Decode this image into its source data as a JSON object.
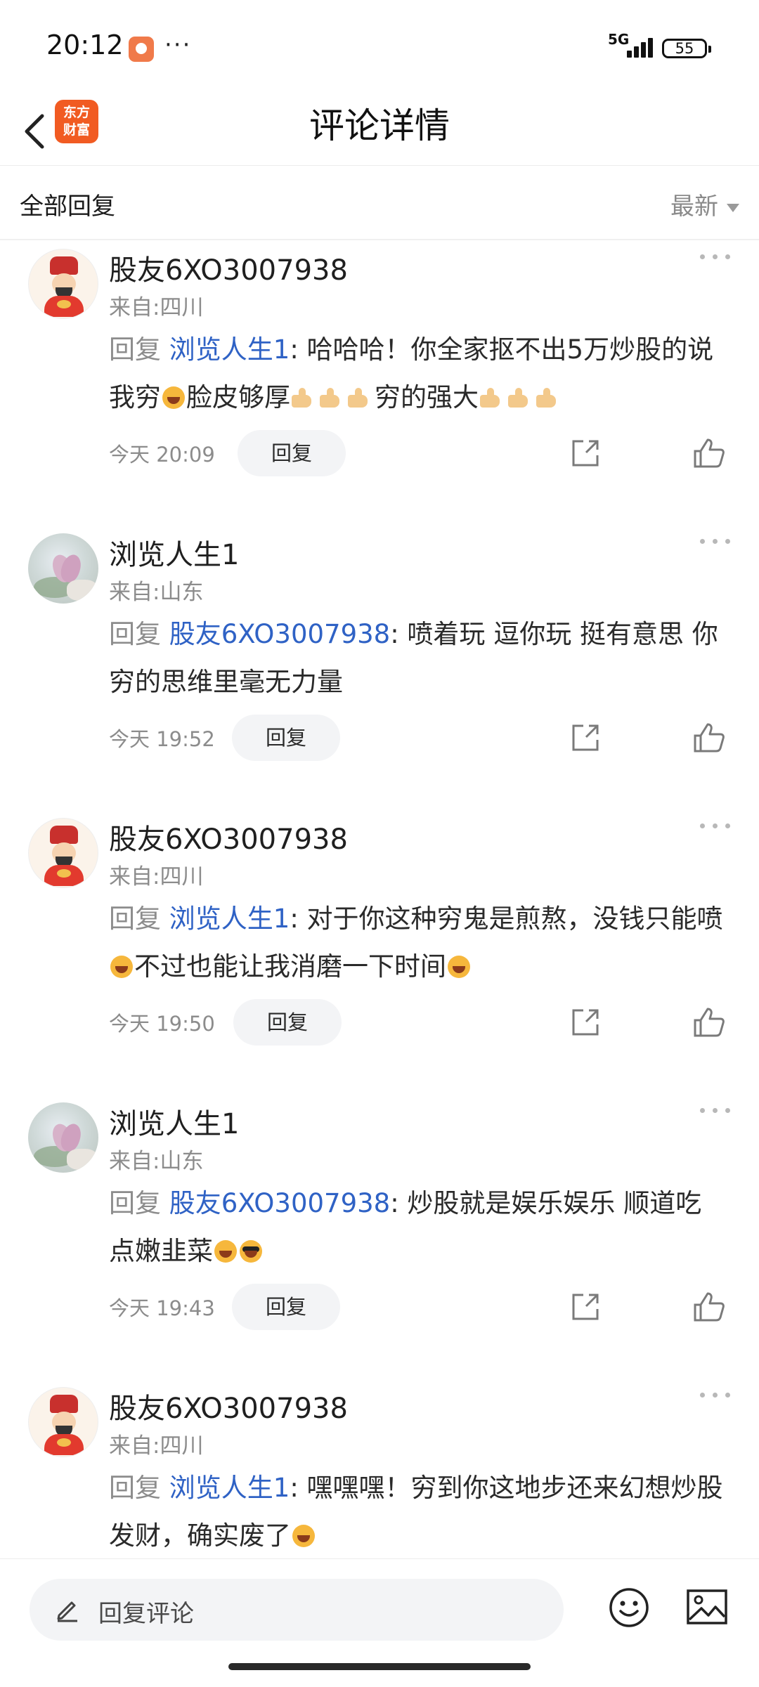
{
  "status_bar": {
    "time": "20:12",
    "more": "···",
    "network": "5G",
    "battery": "55"
  },
  "nav": {
    "logo_line1": "东方",
    "logo_line2": "财富",
    "title": "评论详情"
  },
  "filter": {
    "label": "全部回复",
    "sort": "最新"
  },
  "reply_word": "回复",
  "reply_button": "回复",
  "comments": [
    {
      "username": "股友6XO3007938",
      "region": "来自:四川",
      "reply_to": "浏览人生1",
      "text_parts": [
        ": 哈哈哈！你全家抠不出5万炒股的说我穷",
        "脸皮够厚",
        "穷的强大"
      ],
      "time": "今天 20:09"
    },
    {
      "username": "浏览人生1",
      "region": "来自:山东",
      "reply_to": "股友6XO3007938",
      "text_parts": [
        ": 喷着玩 逗你玩 挺有意思 你穷的思维里毫无力量"
      ],
      "time": "今天 19:52"
    },
    {
      "username": "股友6XO3007938",
      "region": "来自:四川",
      "reply_to": "浏览人生1",
      "text_parts": [
        ": 对于你这种穷鬼是煎熬，没钱只能喷",
        "不过也能让我消磨一下时间"
      ],
      "time": "今天 19:50"
    },
    {
      "username": "浏览人生1",
      "region": "来自:山东",
      "reply_to": "股友6XO3007938",
      "text_parts": [
        ": 炒股就是娱乐娱乐 顺道吃点嫩韭菜"
      ],
      "time": "今天 19:43"
    },
    {
      "username": "股友6XO3007938",
      "region": "来自:四川",
      "reply_to": "浏览人生1",
      "text_parts": [
        ": 嘿嘿嘿！穷到你这地步还来幻想炒股发财，确实废了"
      ]
    }
  ],
  "bottom": {
    "placeholder": "回复评论"
  },
  "colors": {
    "link_blue": "#2f62c5",
    "logo_orange": "#f15b22",
    "muted_gray": "#8c8c8c"
  },
  "icons": [
    "back-arrow-icon",
    "share-icon",
    "like-icon",
    "more-dots-icon",
    "pencil-icon",
    "emoji-icon",
    "image-icon",
    "laughing-emoji-icon",
    "thumbs-up-emoji-icon",
    "sunglasses-emoji-icon"
  ]
}
